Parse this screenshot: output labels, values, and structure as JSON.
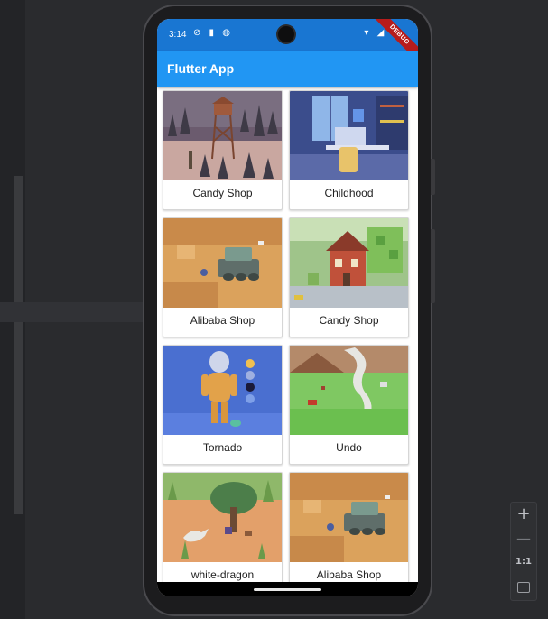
{
  "status_bar": {
    "time": "3:14",
    "left_icons": "⊘ ▮ ◍",
    "right_icons": "▾ ◢ ▮"
  },
  "debug_banner": "DEBUG",
  "app_bar": {
    "title": "Flutter App"
  },
  "cards": [
    {
      "label": "Candy Shop",
      "image": "water-tower-forest-icon"
    },
    {
      "label": "Childhood",
      "image": "desk-room-icon"
    },
    {
      "label": "Alibaba Shop",
      "image": "tank-desert-icon"
    },
    {
      "label": "Candy Shop",
      "image": "brick-house-icon"
    },
    {
      "label": "Tornado",
      "image": "astronaut-figure-icon"
    },
    {
      "label": "Undo",
      "image": "tornado-field-icon"
    },
    {
      "label": "white-dragon",
      "image": "tree-dragon-icon"
    },
    {
      "label": "Alibaba Shop",
      "image": "tank-desert-icon"
    }
  ],
  "zoom_controls": {
    "plus": "+",
    "minus": "—",
    "fit": "1:1"
  },
  "colors": {
    "app_bar": "#2196f3",
    "status_bar": "#1976d2",
    "background": "#2a2b2e"
  }
}
